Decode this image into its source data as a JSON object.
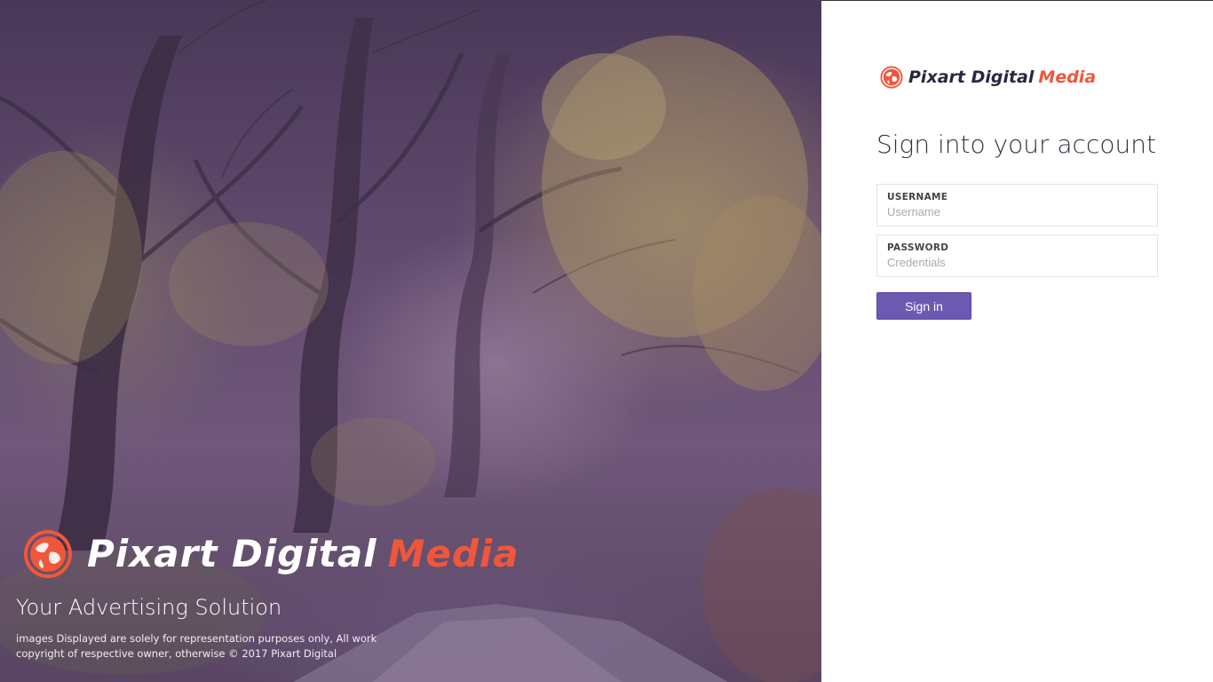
{
  "brand": {
    "name_main": "Pixart Digital",
    "name_accent": "Media",
    "accent_color": "#f0573a",
    "logo_icon": "globe-icon"
  },
  "hero": {
    "tagline": "Your Advertising Solution",
    "disclaimer": "images Displayed are solely for representation purposes only, All work copyright of respective owner, otherwise © 2017 Pixart Digital"
  },
  "login": {
    "title": "Sign into your account",
    "username": {
      "label": "USERNAME",
      "placeholder": "Username",
      "value": ""
    },
    "password": {
      "label": "PASSWORD",
      "placeholder": "Credentials",
      "value": ""
    },
    "submit_label": "Sign in",
    "button_color": "#6c59b2"
  }
}
